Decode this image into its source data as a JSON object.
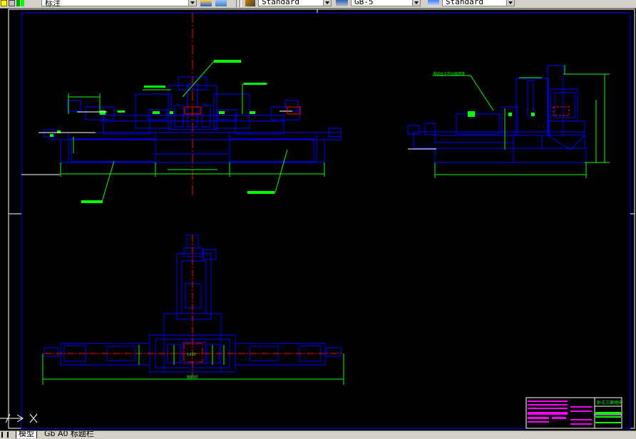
{
  "toolbar": {
    "text_style": "标注",
    "dim_style": "Standard",
    "table_style": "GB-5",
    "multileader_style": "Standard"
  },
  "drawing": {
    "dimensions": {
      "overall_width": "8800",
      "side_view_note": "滑动台工作台面高度",
      "center_label": "1430"
    },
    "title_block": {
      "drawing_name": "卧式三面镗床"
    }
  },
  "layout_tabs": {
    "items": [
      "模型",
      "Gb A0 标题栏"
    ]
  },
  "colors": {
    "background": "#000000",
    "outline": "#0000ff",
    "leader": "#00ff00",
    "centerline": "#ff0000",
    "title_block": "#ff00ff",
    "white": "#ffffff"
  }
}
